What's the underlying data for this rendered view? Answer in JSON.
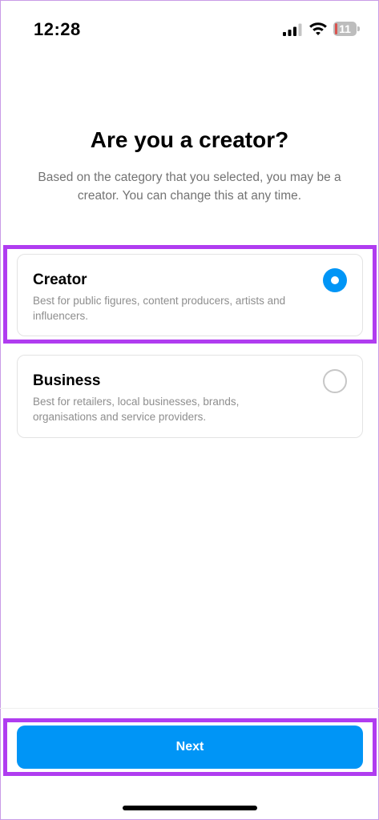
{
  "status_bar": {
    "time": "12:28",
    "battery_level": "11",
    "icons": [
      "signal-icon",
      "wifi-icon",
      "battery-icon"
    ]
  },
  "header": {
    "title": "Are you a creator?",
    "subtitle": "Based on the category that you selected, you may be a creator. You can change this at any time."
  },
  "options": [
    {
      "title": "Creator",
      "description": "Best for public figures, content producers, artists and influencers.",
      "selected": true
    },
    {
      "title": "Business",
      "description": "Best for retailers, local businesses, brands, organisations and service providers.",
      "selected": false
    }
  ],
  "footer": {
    "next_label": "Next"
  },
  "colors": {
    "accent": "#0095f6",
    "highlight": "#b03cf0",
    "battery_low": "#d9534f"
  }
}
